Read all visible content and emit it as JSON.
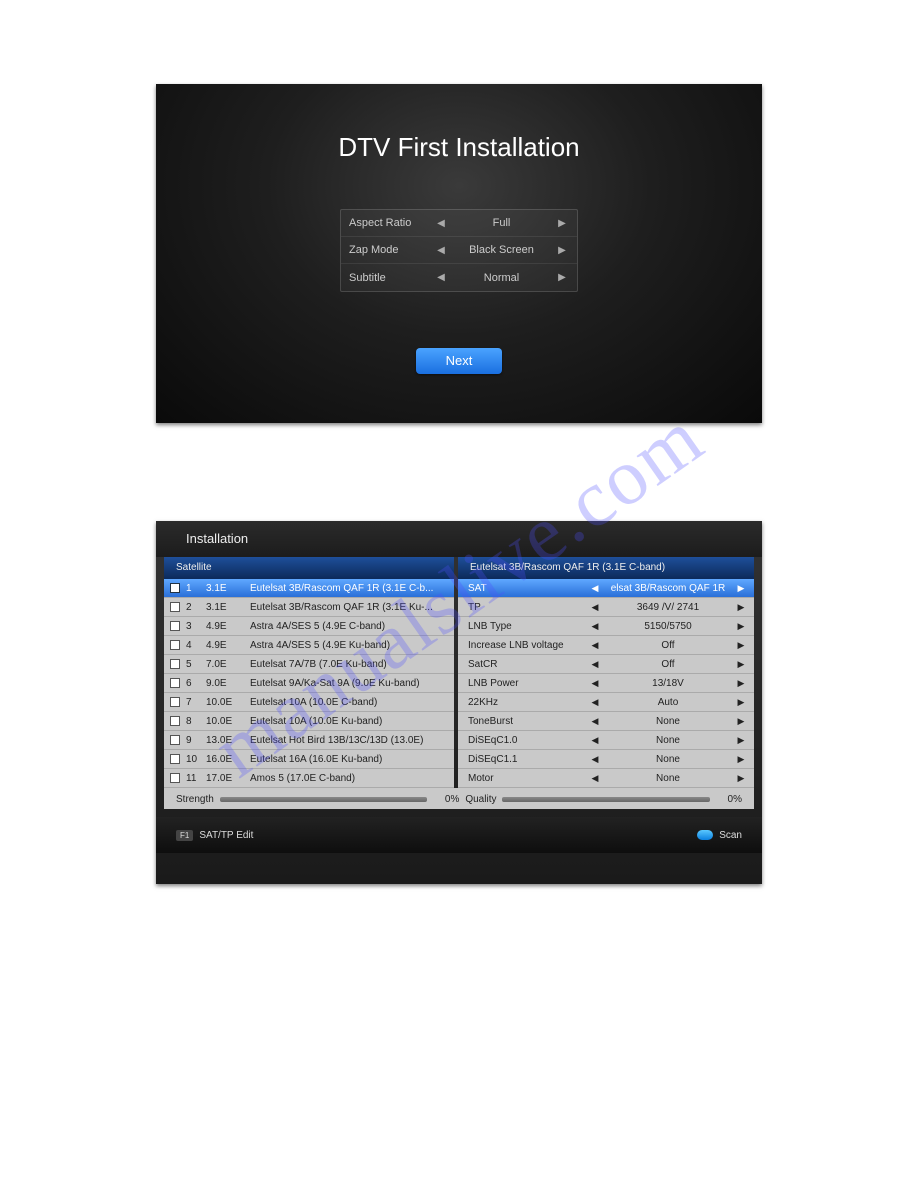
{
  "watermark": "manualslive.com",
  "screen1": {
    "title": "DTV First Installation",
    "settings": [
      {
        "label": "Aspect Ratio",
        "value": "Full"
      },
      {
        "label": "Zap Mode",
        "value": "Black Screen"
      },
      {
        "label": "Subtitle",
        "value": "Normal"
      }
    ],
    "next": "Next"
  },
  "screen2": {
    "title": "Installation",
    "left_header": "Satellite",
    "right_header": "Eutelsat 3B/Rascom QAF 1R (3.1E C-band)",
    "satellites": [
      {
        "num": "1",
        "pos": "3.1E",
        "name": "Eutelsat 3B/Rascom QAF 1R (3.1E C-b...",
        "selected": true
      },
      {
        "num": "2",
        "pos": "3.1E",
        "name": "Eutelsat 3B/Rascom QAF 1R (3.1E Ku-..."
      },
      {
        "num": "3",
        "pos": "4.9E",
        "name": "Astra 4A/SES 5 (4.9E C-band)"
      },
      {
        "num": "4",
        "pos": "4.9E",
        "name": "Astra 4A/SES 5 (4.9E Ku-band)"
      },
      {
        "num": "5",
        "pos": "7.0E",
        "name": "Eutelsat 7A/7B (7.0E Ku-band)"
      },
      {
        "num": "6",
        "pos": "9.0E",
        "name": "Eutelsat 9A/Ka-Sat 9A (9.0E Ku-band)"
      },
      {
        "num": "7",
        "pos": "10.0E",
        "name": "Eutelsat 10A (10.0E C-band)"
      },
      {
        "num": "8",
        "pos": "10.0E",
        "name": "Eutelsat 10A (10.0E Ku-band)"
      },
      {
        "num": "9",
        "pos": "13.0E",
        "name": "Eutelsat Hot Bird 13B/13C/13D (13.0E)"
      },
      {
        "num": "10",
        "pos": "16.0E",
        "name": "Eutelsat 16A (16.0E Ku-band)"
      },
      {
        "num": "11",
        "pos": "17.0E",
        "name": "Amos 5 (17.0E C-band)"
      }
    ],
    "params": [
      {
        "label": "SAT",
        "value": "elsat 3B/Rascom QAF 1R",
        "selected": true
      },
      {
        "label": "TP",
        "value": "3649 /V/ 2741"
      },
      {
        "label": "LNB Type",
        "value": "5150/5750"
      },
      {
        "label": "Increase LNB voltage",
        "value": "Off"
      },
      {
        "label": "SatCR",
        "value": "Off"
      },
      {
        "label": "LNB Power",
        "value": "13/18V"
      },
      {
        "label": "22KHz",
        "value": "Auto"
      },
      {
        "label": "ToneBurst",
        "value": "None"
      },
      {
        "label": "DiSEqC1.0",
        "value": "None"
      },
      {
        "label": "DiSEqC1.1",
        "value": "None"
      },
      {
        "label": "Motor",
        "value": "None"
      }
    ],
    "strength_label": "Strength",
    "strength_pct": "0%",
    "quality_label": "Quality",
    "quality_pct": "0%",
    "footer_f1_key": "F1",
    "footer_f1": "SAT/TP Edit",
    "footer_scan": "Scan"
  }
}
